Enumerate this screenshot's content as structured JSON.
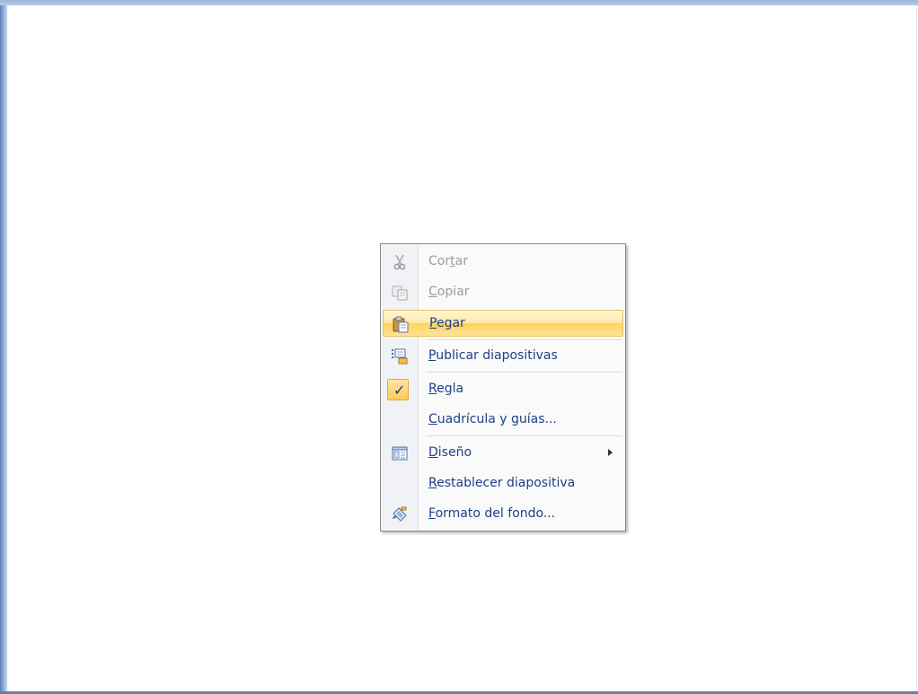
{
  "context_menu": {
    "items": [
      {
        "pre": "Cor",
        "key": "t",
        "post": "ar",
        "enabled": false,
        "icon": "scissors-icon"
      },
      {
        "pre": "",
        "key": "C",
        "post": "opiar",
        "enabled": false,
        "icon": "copy-icon"
      },
      {
        "pre": "",
        "key": "P",
        "post": "egar",
        "enabled": true,
        "highlighted": true,
        "icon": "paste-icon"
      },
      {
        "pre": "",
        "key": "P",
        "post": "ublicar diapositivas",
        "enabled": true,
        "icon": "publish-slides-icon"
      },
      {
        "pre": "",
        "key": "R",
        "post": "egla",
        "enabled": true,
        "checked": true,
        "icon": "checkmark-icon",
        "check_glyph": "✓"
      },
      {
        "pre": "",
        "key": "C",
        "post": "uadrícula y guías...",
        "enabled": true
      },
      {
        "pre": "",
        "key": "D",
        "post": "iseño",
        "enabled": true,
        "submenu": true,
        "icon": "layout-icon"
      },
      {
        "pre": "",
        "key": "R",
        "post": "establecer diapositiva",
        "enabled": true
      },
      {
        "pre": "",
        "key": "F",
        "post": "ormato del fondo...",
        "enabled": true,
        "icon": "format-background-icon"
      }
    ]
  },
  "colors": {
    "accent_text": "#1e3f86",
    "disabled_text": "#9c9c9c",
    "highlight": "#ffe398",
    "window_blue": "#8fb0da"
  }
}
